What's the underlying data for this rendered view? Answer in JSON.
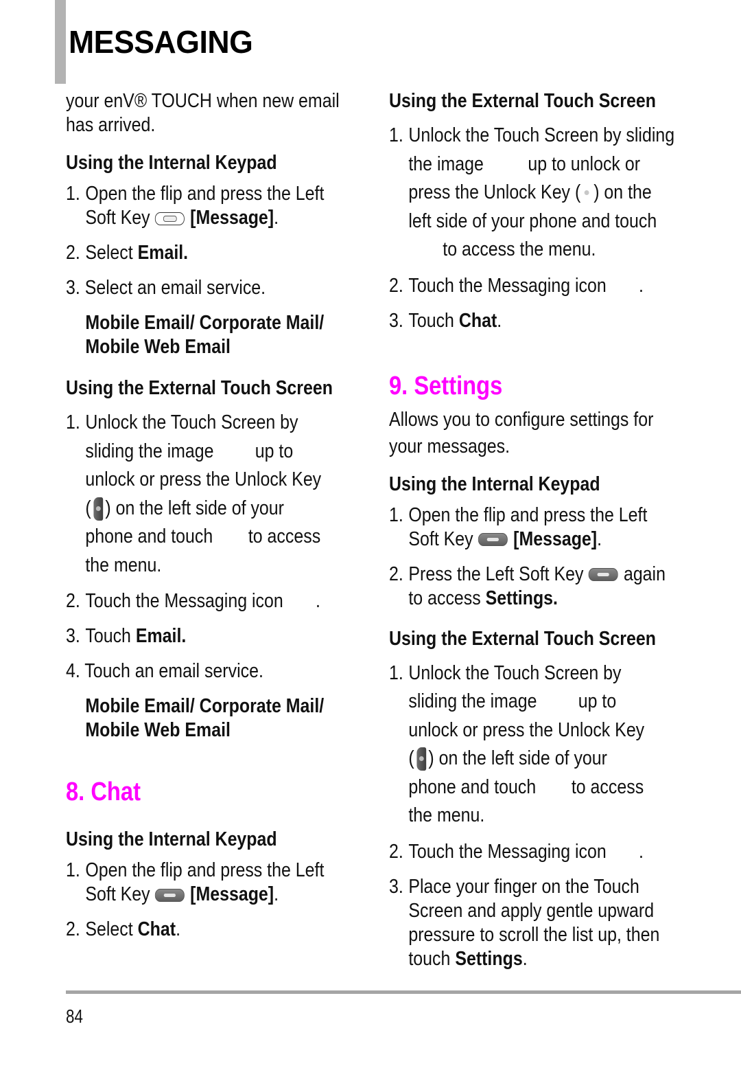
{
  "header": {
    "chapter_title": "MESSAGING"
  },
  "accent_color": "#ff00ff",
  "left": {
    "intro": "your enV® TOUCH when new email has arrived.",
    "intro_line1": "your enV® TOUCH when new email",
    "intro_line2": "has arrived.",
    "email_internal": {
      "heading": "Using the Internal Keypad",
      "step1_line1": "Open the flip and press the Left",
      "step1_line2_pre": "Soft Key",
      "step1_line2_bold": "[Message]",
      "step1_line2_post": ".",
      "step2_pre": "Select ",
      "step2_bold": "Email.",
      "step3": "3. Select an email service.",
      "services_line1": "Mobile Email/ Corporate Mail/",
      "services_line2": "Mobile Web Email"
    },
    "email_external": {
      "heading": "Using the External Touch Screen",
      "step1_lines": [
        "Unlock the Touch Screen by",
        "sliding the image",
        "up to",
        "unlock or press the Unlock Key",
        ") on the left side of your",
        "phone and touch",
        "to access",
        "the menu."
      ],
      "step2": "Touch the Messaging icon",
      "step2_end": ".",
      "step3_pre": "Touch ",
      "step3_bold": "Email.",
      "step4": "4. Touch an email service.",
      "services_line1": "Mobile Email/ Corporate Mail/",
      "services_line2": "Mobile Web Email"
    },
    "chat": {
      "title": "8. Chat",
      "internal_heading": "Using the Internal Keypad",
      "step1_line1": "Open the flip and press the Left",
      "step1_line2_pre": "Soft Key",
      "step1_line2_bold": "[Message]",
      "step1_line2_post": ".",
      "step2_pre": "Select ",
      "step2_bold": "Chat",
      "step2_post": "."
    }
  },
  "right": {
    "chat_external": {
      "heading": "Using the External Touch Screen",
      "step1_lines": [
        "Unlock the Touch Screen by sliding",
        "the image",
        "up to unlock or",
        "press the Unlock Key (",
        ") on the",
        "left side of your phone and touch",
        "to access the menu."
      ],
      "step2": "Touch the Messaging icon",
      "step2_end": ".",
      "step3_pre": "Touch ",
      "step3_bold": "Chat",
      "step3_post": "."
    },
    "settings": {
      "title": "9. Settings",
      "description_line1": "Allows you to configure settings for",
      "description_line2": "your messages.",
      "internal_heading": "Using the Internal Keypad",
      "step1_line1": "Open the flip and press the Left",
      "step1_line2_pre": "Soft Key",
      "step1_line2_bold": "[Message]",
      "step1_line2_post": ".",
      "step2_line1_pre": "Press the Left Soft Key",
      "step2_line1_post": "again",
      "step2_line2_pre": "to access ",
      "step2_line2_bold": "Settings.",
      "external_heading": "Using the External Touch Screen",
      "ext_step1_lines": [
        "Unlock the Touch Screen by",
        "sliding the image",
        "up to",
        "unlock or press the Unlock Key",
        ") on the left side of your",
        "phone and touch",
        "to access",
        "the menu."
      ],
      "ext_step2": "Touch the Messaging icon",
      "ext_step2_end": ".",
      "ext_step3_lines": [
        "Place your finger on the Touch",
        "Screen and apply gentle upward",
        "pressure to scroll the list up, then"
      ],
      "ext_step3_last_pre": "touch ",
      "ext_step3_last_bold": "Settings",
      "ext_step3_last_post": "."
    }
  },
  "numbers": {
    "n1": "1.",
    "n2": "2.",
    "n3": "3."
  },
  "footer": {
    "page_number": "84"
  }
}
